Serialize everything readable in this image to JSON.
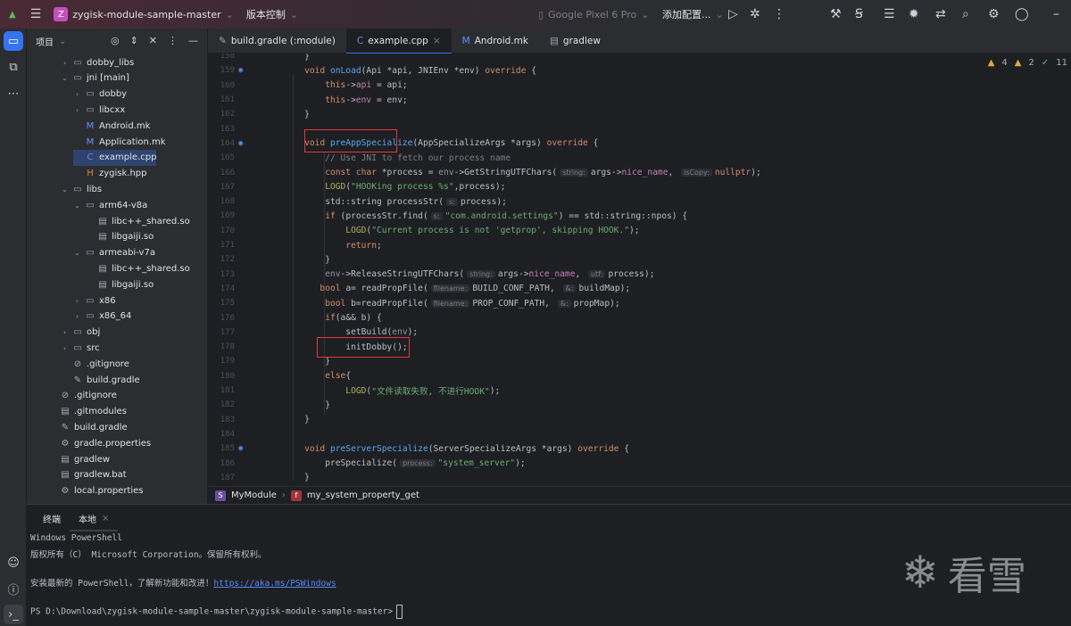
{
  "titlebar": {
    "project_initial": "Z",
    "project_name": "zygisk-module-sample-master",
    "vcs": "版本控制",
    "device": "Google Pixel 6 Pro",
    "run_config": "添加配置...",
    "icons": [
      "android-icon",
      "hamburger-menu-icon",
      "run-icon",
      "debug-icon",
      "more-icon",
      "build-icon",
      "translate-icon",
      "coverage-icon",
      "bug-icon",
      "device-sync-icon",
      "search-icon",
      "settings-icon",
      "account-icon",
      "minimize-icon"
    ]
  },
  "project_panel": {
    "title": "项目",
    "tree": [
      {
        "label": "dobby_libs",
        "depth": 2,
        "type": "folder",
        "expanded": false
      },
      {
        "label": "jni [main]",
        "depth": 2,
        "type": "folder",
        "expanded": true
      },
      {
        "label": "dobby",
        "depth": 3,
        "type": "folder",
        "expanded": false
      },
      {
        "label": "libcxx",
        "depth": 3,
        "type": "folder",
        "expanded": false
      },
      {
        "label": "Android.mk",
        "depth": 3,
        "type": "mk"
      },
      {
        "label": "Application.mk",
        "depth": 3,
        "type": "mk"
      },
      {
        "label": "example.cpp",
        "depth": 3,
        "type": "cpp"
      },
      {
        "label": "zygisk.hpp",
        "depth": 3,
        "type": "hpp"
      },
      {
        "label": "libs",
        "depth": 2,
        "type": "folder",
        "expanded": true
      },
      {
        "label": "arm64-v8a",
        "depth": 3,
        "type": "folder",
        "expanded": true
      },
      {
        "label": "libc++_shared.so",
        "depth": 4,
        "type": "file"
      },
      {
        "label": "libgaiji.so",
        "depth": 4,
        "type": "file"
      },
      {
        "label": "armeabi-v7a",
        "depth": 3,
        "type": "folder",
        "expanded": true
      },
      {
        "label": "libc++_shared.so",
        "depth": 4,
        "type": "file"
      },
      {
        "label": "libgaiji.so",
        "depth": 4,
        "type": "file"
      },
      {
        "label": "x86",
        "depth": 3,
        "type": "folder",
        "expanded": false
      },
      {
        "label": "x86_64",
        "depth": 3,
        "type": "folder",
        "expanded": false
      },
      {
        "label": "obj",
        "depth": 2,
        "type": "folder",
        "expanded": false
      },
      {
        "label": "src",
        "depth": 2,
        "type": "folder",
        "expanded": false
      },
      {
        "label": ".gitignore",
        "depth": 2,
        "type": "gitignore"
      },
      {
        "label": "build.gradle",
        "depth": 2,
        "type": "gradle"
      },
      {
        "label": ".gitignore",
        "depth": 1,
        "type": "gitignore"
      },
      {
        "label": ".gitmodules",
        "depth": 1,
        "type": "file"
      },
      {
        "label": "build.gradle",
        "depth": 1,
        "type": "gradle"
      },
      {
        "label": "gradle.properties",
        "depth": 1,
        "type": "settings"
      },
      {
        "label": "gradlew",
        "depth": 1,
        "type": "file"
      },
      {
        "label": "gradlew.bat",
        "depth": 1,
        "type": "file"
      },
      {
        "label": "local.properties",
        "depth": 1,
        "type": "settings"
      }
    ]
  },
  "tabs": [
    {
      "label": "build.gradle (:module)",
      "icon": "gradle-icon",
      "active": false
    },
    {
      "label": "example.cpp",
      "icon": "cpp-icon",
      "active": true
    },
    {
      "label": "Android.mk",
      "icon": "makefile-icon",
      "active": false
    },
    {
      "label": "gradlew",
      "icon": "file-icon",
      "active": false
    }
  ],
  "inspections": {
    "warnings": "4",
    "weak_warnings": "2",
    "ok": "11"
  },
  "code": [
    {
      "n": "158",
      "t": [
        [
          "pl",
          "    }"
        ]
      ]
    },
    {
      "n": "159",
      "g": true,
      "t": [
        [
          "kw",
          "    void "
        ],
        [
          "fn",
          "onLoad"
        ],
        [
          "pl",
          "(Api *api, JNIEnv *env) "
        ],
        [
          "kw",
          "override"
        ],
        [
          "pl",
          " {"
        ]
      ]
    },
    {
      "n": "160",
      "t": [
        [
          "kw",
          "        this"
        ],
        [
          "pl",
          "->"
        ],
        [
          "fld",
          "api"
        ],
        [
          "pl",
          " = api;"
        ]
      ]
    },
    {
      "n": "161",
      "t": [
        [
          "kw",
          "        this"
        ],
        [
          "pl",
          "->"
        ],
        [
          "fld",
          "env"
        ],
        [
          "pl",
          " = env;"
        ]
      ]
    },
    {
      "n": "162",
      "t": [
        [
          "pl",
          "    }"
        ]
      ]
    },
    {
      "n": "163",
      "t": []
    },
    {
      "n": "164",
      "g": true,
      "t": [
        [
          "kw",
          "    void "
        ],
        [
          "fn",
          "preAppSpecialize"
        ],
        [
          "pl",
          "(AppSpecializeArgs *args) "
        ],
        [
          "kw",
          "override"
        ],
        [
          "pl",
          " {"
        ]
      ]
    },
    {
      "n": "165",
      "t": [
        [
          "cm",
          "        // Use JNI to fetch our process name"
        ]
      ]
    },
    {
      "n": "166",
      "t": [
        [
          "kw",
          "        const char "
        ],
        [
          "pl",
          "*process = "
        ],
        [
          "par",
          "env"
        ],
        [
          "pl",
          "->GetStringUTFChars("
        ],
        [
          "hint",
          "string:"
        ],
        [
          "pl",
          "args->"
        ],
        [
          "fld",
          "nice_name"
        ],
        [
          "pl",
          ", "
        ],
        [
          "hint",
          "isCopy:"
        ],
        [
          "kw",
          "nullptr"
        ],
        [
          "pl",
          ");"
        ]
      ]
    },
    {
      "n": "167",
      "t": [
        [
          "mac",
          "        LOGD"
        ],
        [
          "pl",
          "("
        ],
        [
          "str",
          "\"HOOKing process %s\""
        ],
        [
          "pl",
          ",process);"
        ]
      ]
    },
    {
      "n": "168",
      "t": [
        [
          "pl",
          "        std::string processStr("
        ],
        [
          "hint",
          "s:"
        ],
        [
          "pl",
          "process);"
        ]
      ]
    },
    {
      "n": "169",
      "t": [
        [
          "kw",
          "        if "
        ],
        [
          "pl",
          "(processStr.find("
        ],
        [
          "hint",
          "s:"
        ],
        [
          "str",
          "\"com.android.settings\""
        ],
        [
          "pl",
          ") == std::string::npos) {"
        ]
      ]
    },
    {
      "n": "170",
      "t": [
        [
          "mac",
          "            LOGD"
        ],
        [
          "pl",
          "("
        ],
        [
          "str",
          "\"Current process is not 'getprop', skipping HOOK.\""
        ],
        [
          "pl",
          ");"
        ]
      ]
    },
    {
      "n": "171",
      "t": [
        [
          "kw",
          "            return"
        ],
        [
          "pl",
          ";"
        ]
      ]
    },
    {
      "n": "172",
      "t": [
        [
          "pl",
          "        }"
        ]
      ]
    },
    {
      "n": "173",
      "t": [
        [
          "par",
          "        env"
        ],
        [
          "pl",
          "->ReleaseStringUTFChars("
        ],
        [
          "hint",
          "string:"
        ],
        [
          "pl",
          "args->"
        ],
        [
          "fld",
          "nice_name"
        ],
        [
          "pl",
          ", "
        ],
        [
          "hint",
          "utf:"
        ],
        [
          "pl",
          "process);"
        ]
      ]
    },
    {
      "n": "174",
      "t": [
        [
          "kw",
          "       bool "
        ],
        [
          "pl",
          "a= readPropFile("
        ],
        [
          "hint",
          "filename:"
        ],
        [
          "pl",
          "BUILD_CONF_PATH, "
        ],
        [
          "hint",
          "&:"
        ],
        [
          "pl",
          "buildMap);"
        ]
      ]
    },
    {
      "n": "175",
      "t": [
        [
          "kw",
          "        bool "
        ],
        [
          "pl",
          "b=readPropFile("
        ],
        [
          "hint",
          "filename:"
        ],
        [
          "pl",
          "PROP_CONF_PATH, "
        ],
        [
          "hint",
          "&:"
        ],
        [
          "pl",
          "propMap);"
        ]
      ]
    },
    {
      "n": "176",
      "t": [
        [
          "kw",
          "        if"
        ],
        [
          "pl",
          "(a&& b) {"
        ]
      ]
    },
    {
      "n": "177",
      "t": [
        [
          "pl",
          "            setBuild("
        ],
        [
          "par",
          "env"
        ],
        [
          "pl",
          ");"
        ]
      ]
    },
    {
      "n": "178",
      "t": [
        [
          "pl",
          "            initDobby();"
        ]
      ]
    },
    {
      "n": "179",
      "t": [
        [
          "pl",
          "        }"
        ]
      ]
    },
    {
      "n": "180",
      "t": [
        [
          "kw",
          "        else"
        ],
        [
          "pl",
          "{"
        ]
      ]
    },
    {
      "n": "181",
      "t": [
        [
          "mac",
          "            LOGD"
        ],
        [
          "pl",
          "("
        ],
        [
          "str",
          "\"文件读取失败, 不进行HOOK\""
        ],
        [
          "pl",
          ");"
        ]
      ]
    },
    {
      "n": "182",
      "t": [
        [
          "pl",
          "        }"
        ]
      ]
    },
    {
      "n": "183",
      "t": [
        [
          "pl",
          "    }"
        ]
      ]
    },
    {
      "n": "184",
      "t": []
    },
    {
      "n": "185",
      "g": true,
      "t": [
        [
          "kw",
          "    void "
        ],
        [
          "fn",
          "preServerSpecialize"
        ],
        [
          "pl",
          "(ServerSpecializeArgs *args) "
        ],
        [
          "kw",
          "override"
        ],
        [
          "pl",
          " {"
        ]
      ]
    },
    {
      "n": "186",
      "t": [
        [
          "pl",
          "        preSpecialize("
        ],
        [
          "hint",
          "process:"
        ],
        [
          "str",
          "\"system_server\""
        ],
        [
          "pl",
          ");"
        ]
      ]
    },
    {
      "n": "187",
      "t": [
        [
          "pl",
          "    }"
        ]
      ]
    }
  ],
  "breadcrumb": [
    {
      "label": "MyModule",
      "icon": "struct-icon"
    },
    {
      "label": "my_system_property_get",
      "icon": "function-icon"
    }
  ],
  "terminal": {
    "tabs": [
      {
        "label": "终端",
        "closable": false
      },
      {
        "label": "本地",
        "closable": true
      }
    ],
    "line1": "Windows PowerShell",
    "line2": "版权所有（C） Microsoft Corporation。保留所有权利。",
    "line3_prefix": "安装最新的 PowerShell，了解新功能和改进！",
    "line3_link": "https://aka.ms/PSWindows",
    "prompt": "PS D:\\Download\\zygisk-module-sample-master\\zygisk-module-sample-master>"
  },
  "watermark": {
    "text": "看雪"
  },
  "colors": {
    "accent": "#3574f0",
    "highlight_box": "#e0393e"
  }
}
